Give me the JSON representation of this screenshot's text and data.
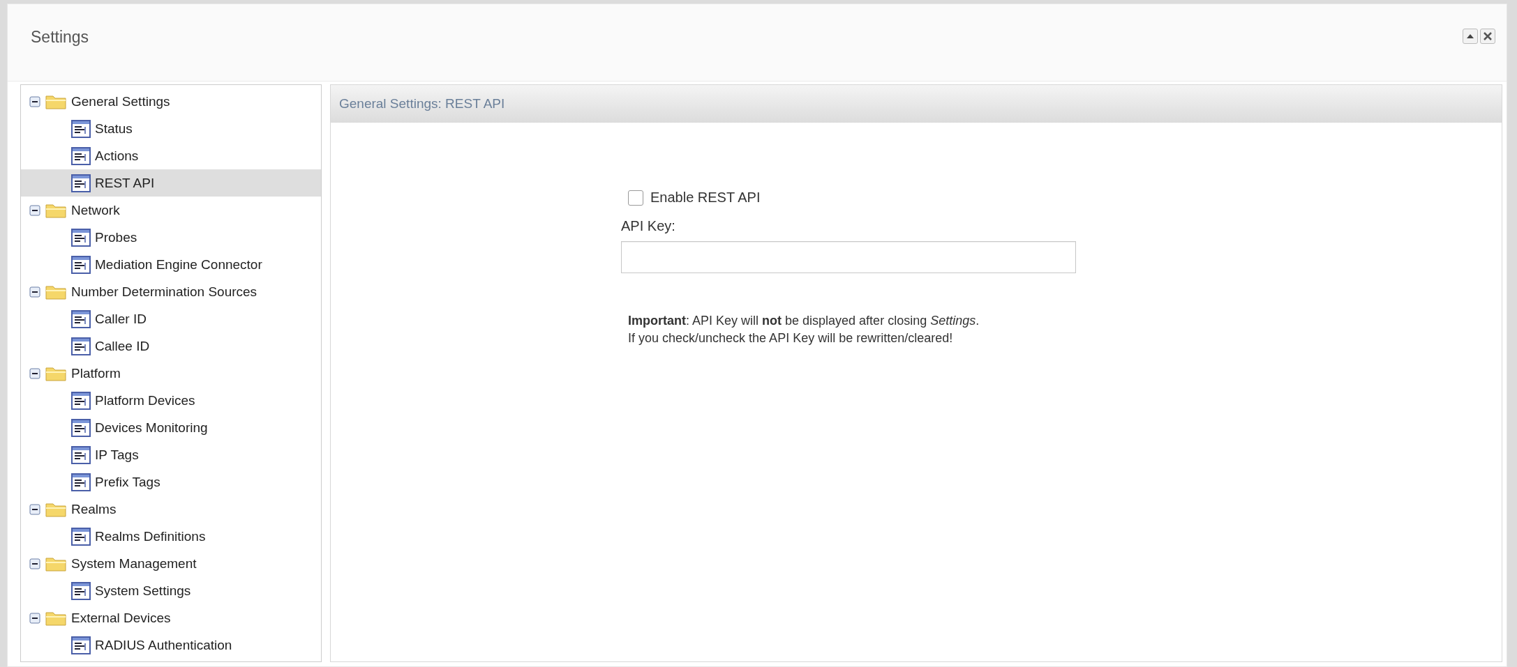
{
  "window": {
    "title": "Settings"
  },
  "window_buttons": [
    {
      "kind": "collapse"
    },
    {
      "kind": "close"
    }
  ],
  "tree": [
    {
      "label": "General Settings",
      "expanded": true,
      "selected": false,
      "children": [
        {
          "label": "Status",
          "selected": false
        },
        {
          "label": "Actions",
          "selected": false
        },
        {
          "label": "REST API",
          "selected": true
        }
      ]
    },
    {
      "label": "Network",
      "expanded": true,
      "selected": false,
      "children": [
        {
          "label": "Probes",
          "selected": false
        },
        {
          "label": "Mediation Engine Connector",
          "selected": false
        }
      ]
    },
    {
      "label": "Number Determination Sources",
      "expanded": true,
      "selected": false,
      "children": [
        {
          "label": "Caller ID",
          "selected": false
        },
        {
          "label": "Callee ID",
          "selected": false
        }
      ]
    },
    {
      "label": "Platform",
      "expanded": true,
      "selected": false,
      "children": [
        {
          "label": "Platform Devices",
          "selected": false
        },
        {
          "label": "Devices Monitoring",
          "selected": false
        },
        {
          "label": "IP Tags",
          "selected": false
        },
        {
          "label": "Prefix Tags",
          "selected": false
        }
      ]
    },
    {
      "label": "Realms",
      "expanded": true,
      "selected": false,
      "children": [
        {
          "label": "Realms Definitions",
          "selected": false
        }
      ]
    },
    {
      "label": "System Management",
      "expanded": true,
      "selected": false,
      "children": [
        {
          "label": "System Settings",
          "selected": false
        }
      ]
    },
    {
      "label": "External Devices",
      "expanded": true,
      "selected": false,
      "children": [
        {
          "label": "RADIUS Authentication",
          "selected": false
        }
      ]
    }
  ],
  "panel": {
    "title": "General Settings: REST API",
    "enable_checkbox": {
      "label": "Enable REST API",
      "checked": false
    },
    "api_key": {
      "label": "API Key:"
    },
    "notes": [
      "**Important**: API Key will **not** be displayed after closing *Settings*.",
      "If you check/uncheck the API Key will be rewritten/cleared!"
    ]
  }
}
